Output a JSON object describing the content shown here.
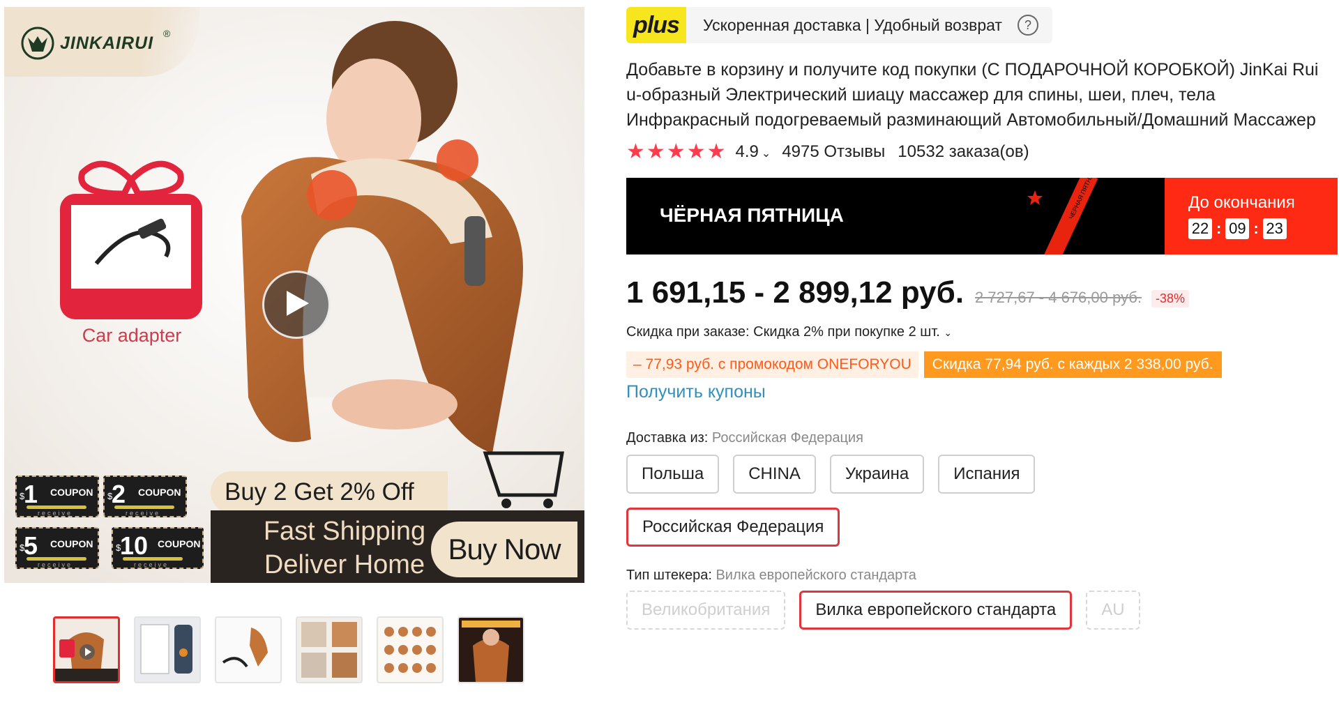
{
  "gallery": {
    "brand": "JINKAIRUI",
    "brand_mark": "®",
    "gift_title": "GIFT",
    "gift_subtitle": "Car adapter",
    "coupons": [
      {
        "currency": "$",
        "amount": "1",
        "label": "COUPON",
        "receive": "receive"
      },
      {
        "currency": "$",
        "amount": "2",
        "label": "COUPON",
        "receive": "receive"
      },
      {
        "currency": "$",
        "amount": "5",
        "label": "COUPON",
        "receive": "receive"
      },
      {
        "currency": "$",
        "amount": "10",
        "label": "COUPON",
        "receive": "receive"
      }
    ],
    "promo_buy2": "Buy 2 Get 2% Off",
    "promo_fast_line1": "Fast Shipping",
    "promo_fast_line2": "Deliver Home",
    "promo_buy_now": "Buy Now",
    "thumbnails_count": 6,
    "active_thumbnail": 1
  },
  "plus": {
    "badge": "plus",
    "text": "Ускоренная доставка | Удобный возврат",
    "help_icon": "question-circle-icon"
  },
  "product": {
    "title": "Добавьте в корзину и получите код покупки (С ПОДАРОЧНОЙ КОРОБКОЙ) JinKai Rui u-образный Электрический шиацу массажер для спины, шеи, плеч, тела Инфракрасный подогреваемый разминающий Автомобильный/Домашний Массажер",
    "rating": "4.9",
    "stars": 5,
    "reviews": "4975 Отзывы",
    "orders": "10532 заказа(ов)"
  },
  "black_friday": {
    "title": "ЧЁРНАЯ ПЯТНИЦА",
    "ribbon": "ЧЕРНАЯ ПЯТНИЦА",
    "timer_label": "До окончания",
    "hours": "22",
    "minutes": "09",
    "seconds": "23"
  },
  "price": {
    "current": "1 691,15 - 2 899,12 руб.",
    "old": "2 727,67 - 4 676,00 руб.",
    "discount": "-38%"
  },
  "discounts": {
    "order_discount": "Скидка при заказе: Скидка 2% при покупке 2 шт.",
    "promo_code": "– 77,93 руб. с промокодом ONEFORYOU",
    "each_discount": "Скидка 77,94 руб. с каждых 2 338,00 руб.",
    "coupons_link": "Получить купоны"
  },
  "shipping": {
    "label": "Доставка из:",
    "selected": "Российская Федерация",
    "options": [
      "Польша",
      "CHINA",
      "Украина",
      "Испания",
      "Российская Федерация"
    ]
  },
  "plug": {
    "label": "Тип штекера:",
    "selected": "Вилка европейского стандарта",
    "options": [
      "Великобритания",
      "Вилка европейского стандарта",
      "AU"
    ]
  },
  "colors": {
    "accent_red": "#e22d2d",
    "black_friday_timer": "#ff2a14",
    "plus_yellow": "#f7e61d",
    "promo_orange": "#ff9a1f",
    "link_blue": "#2f8fbf"
  }
}
